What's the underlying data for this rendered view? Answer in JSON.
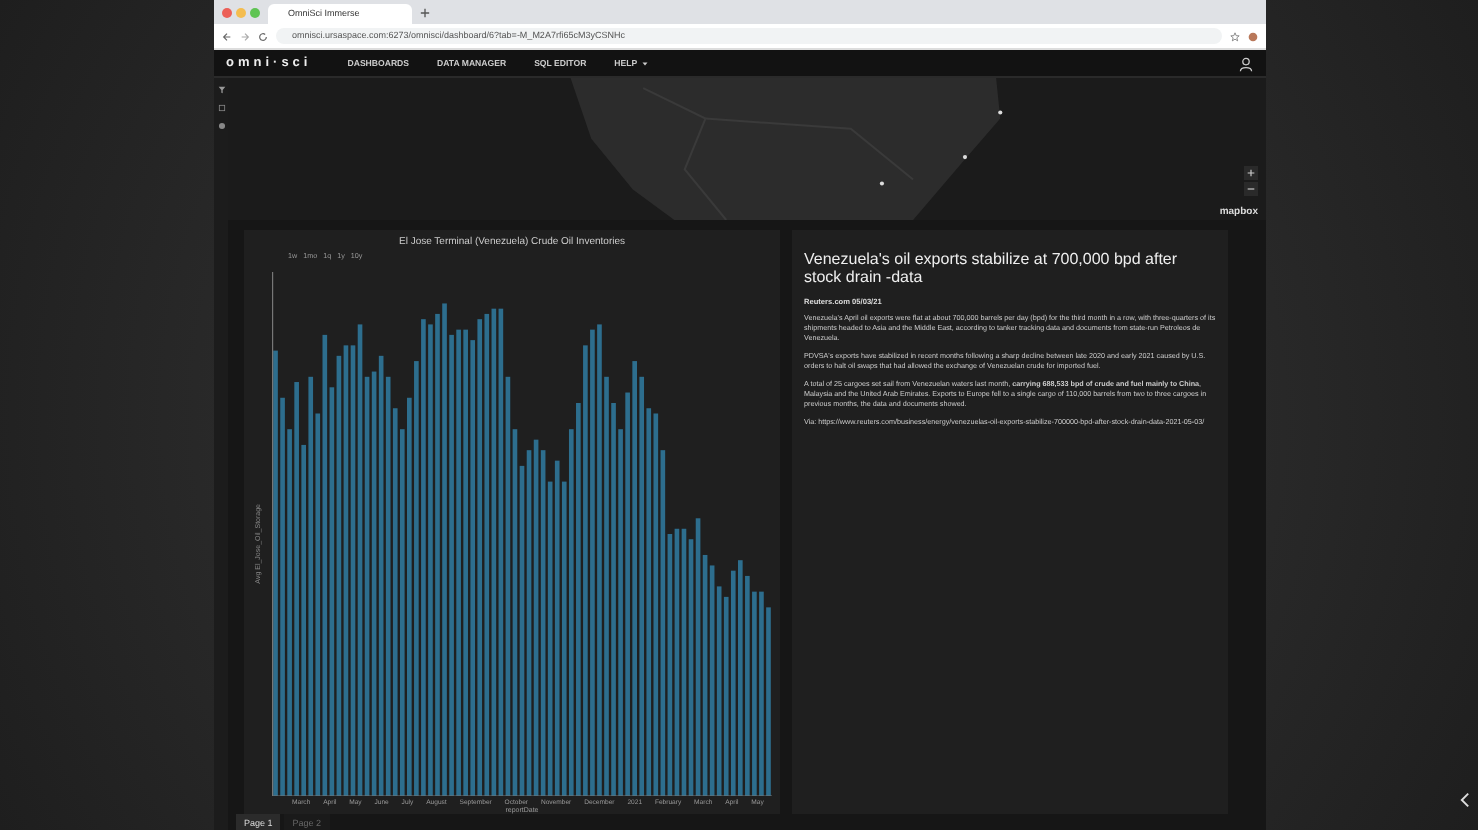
{
  "browser": {
    "tab_title": "OmniSci Immerse",
    "url": "omnisci.ursaspace.com:6273/omnisci/dashboard/6?tab=-M_M2A7rfi65cM3yCSNHc"
  },
  "app": {
    "logo": "omni·sci",
    "nav": [
      {
        "label": "DASHBOARDS",
        "has_menu": false
      },
      {
        "label": "DATA MANAGER",
        "has_menu": false
      },
      {
        "label": "SQL EDITOR",
        "has_menu": false
      },
      {
        "label": "HELP",
        "has_menu": true
      }
    ]
  },
  "map": {
    "logo": "mapbox"
  },
  "chart": {
    "title": "El Jose Terminal (Venezuela) Crude Oil Inventories",
    "ranges": [
      "1w",
      "1mo",
      "1q",
      "1y",
      "10y"
    ],
    "y_title": "Avg El_Jose_Oil_Storage",
    "x_title": "reportDate",
    "x_labels": [
      "March",
      "April",
      "May",
      "June",
      "July",
      "August",
      "September",
      "October",
      "November",
      "December",
      "2021",
      "February",
      "March",
      "April",
      "May"
    ]
  },
  "article": {
    "headline": "Venezuela's oil exports stabilize at 700,000 bpd after stock drain -data",
    "source": "Reuters.com 05/03/21",
    "paragraphs": [
      "Venezuela's April oil exports were flat at about 700,000 barrels per day (bpd) for the third month in a row, with three-quarters of its shipments headed to Asia and the Middle East, according to tanker tracking data and documents from state-run Petroleos de Venezuela.",
      "PDVSA's exports have stabilized in recent months following a sharp decline between late 2020 and early 2021 caused by U.S. orders to halt oil swaps that had allowed the exchange of Venezuelan crude for imported fuel.",
      "A total of 25 cargoes set sail from Venezuelan waters last month, **carrying 688,533 bpd of crude and fuel mainly to China**, Malaysia and the United Arab Emirates. Exports to Europe fell to a single cargo of 110,000 barrels from two to three cargoes in previous months, the data and documents showed.",
      "Via: https://www.reuters.com/business/energy/venezuelas-oil-exports-stabilize-700000-bpd-after-stock-drain-data-2021-05-03/"
    ]
  },
  "pages": [
    {
      "label": "Page 1",
      "selected": true
    },
    {
      "label": "Page 2",
      "selected": false
    }
  ]
}
